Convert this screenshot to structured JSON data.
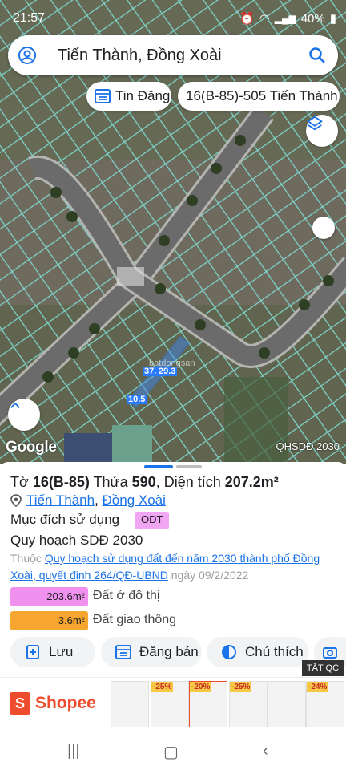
{
  "status": {
    "time": "21:57",
    "battery": "40%",
    "signal1": "Vo) LTE1",
    "signal2": "Vo) LTE2"
  },
  "search": {
    "text": "Tiến Thành, Đồng Xoài"
  },
  "chips": {
    "tin_dang": "Tin Đăng",
    "parcel": "16(B-85)-505 Tiến Thành"
  },
  "map": {
    "google": "Google",
    "layer_label": "QHSDĐ 2030",
    "dim1": "37.",
    "dim2": "29.3",
    "dim3": "10.5",
    "watermark": "batdongsan"
  },
  "sheet": {
    "to_label": "Tờ",
    "to_value": "16(B-85)",
    "thua_label": "Thửa",
    "thua_value": "590",
    "area_label": ", Diện tích",
    "area_value": "207.2m²",
    "commune": "Tiến Thành",
    "district": "Đồng Xoài",
    "purpose_label": "Mục đích sử dụng",
    "purpose_badge": "ODT",
    "plan_label": "Quy hoạch SDĐ 2030",
    "note_prefix": "Thuộc",
    "note_link": "Quy hoạch sử dụng đất đến năm 2030 thành phố Đồng Xoài, quyết định 264/QĐ-UBND",
    "note_date": "ngày 09/2/2022",
    "bars": [
      {
        "value": "203.6m²",
        "label": "Đất ở đô thị",
        "color": "#f090ef"
      },
      {
        "value": "3.6m²",
        "label": "Đất giao thông",
        "color": "#f6a52f"
      }
    ],
    "actions": {
      "save": "Lưu",
      "post": "Đăng bán",
      "legend": "Chú thích"
    }
  },
  "ad": {
    "brand": "Shopee",
    "close": "TẮT QC",
    "discounts": [
      "-25%",
      "-20%",
      "-25%",
      "-24%"
    ]
  },
  "colors": {
    "accent": "#1a73e8",
    "odt": "#f2a5f2",
    "transport": "#f6a52f"
  }
}
